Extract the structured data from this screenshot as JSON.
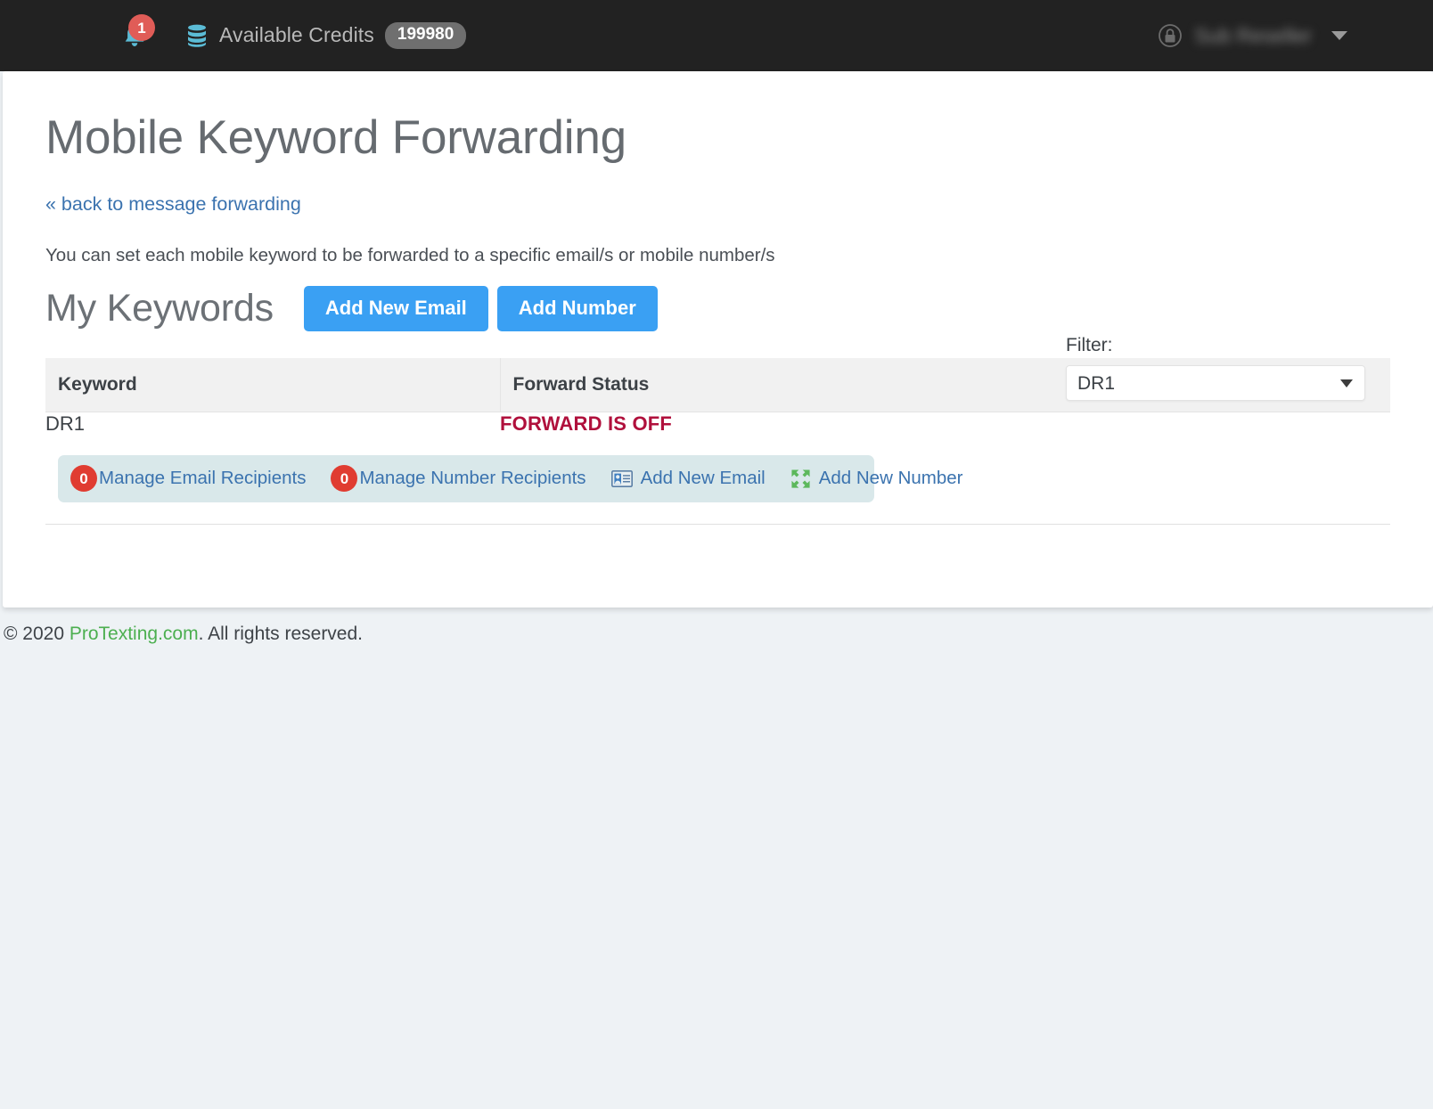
{
  "topbar": {
    "notifications": {
      "icon": "bell-icon",
      "badge_count": "1"
    },
    "credits": {
      "icon": "database-icon",
      "label": "Available Credits",
      "value": "199980"
    },
    "account": {
      "lock_icon": "lock-icon",
      "user_name": "Sub Reseller",
      "caret_icon": "chevron-down-icon"
    }
  },
  "page": {
    "title": "Mobile Keyword Forwarding",
    "back_link": "« back to message forwarding",
    "intro": "You can set each mobile keyword to be forwarded to a specific email/s or mobile number/s",
    "section_title": "My Keywords",
    "add_email_button": "Add New Email",
    "add_number_button": "Add Number"
  },
  "filter": {
    "label": "Filter:",
    "selected": "DR1",
    "options": [
      "DR1"
    ]
  },
  "table": {
    "columns": [
      "Keyword",
      "Forward Status"
    ],
    "rows": [
      {
        "keyword": "DR1",
        "status": "FORWARD IS OFF",
        "actions": {
          "email_recipients": {
            "count": "0",
            "label": "Manage Email Recipients"
          },
          "number_recipients": {
            "count": "0",
            "label": "Manage Number Recipients"
          },
          "add_new_email": {
            "icon": "vcard-icon",
            "label": "Add New Email"
          },
          "add_new_number": {
            "icon": "arrows-expand-icon",
            "label": "Add New Number"
          }
        }
      }
    ]
  },
  "footer": {
    "prefix": "© 2020 ",
    "brand": "ProTexting.com",
    "suffix": ". All rights reserved."
  },
  "colors": {
    "topbar_bg": "#222222",
    "accent_blue": "#3aa0f3",
    "link_blue": "#3b73af",
    "status_red": "#b0103c",
    "badge_red": "#e03c31",
    "action_bar_bg": "#d9e8ea",
    "brand_green": "#4caf50",
    "page_bg": "#eef2f5"
  }
}
